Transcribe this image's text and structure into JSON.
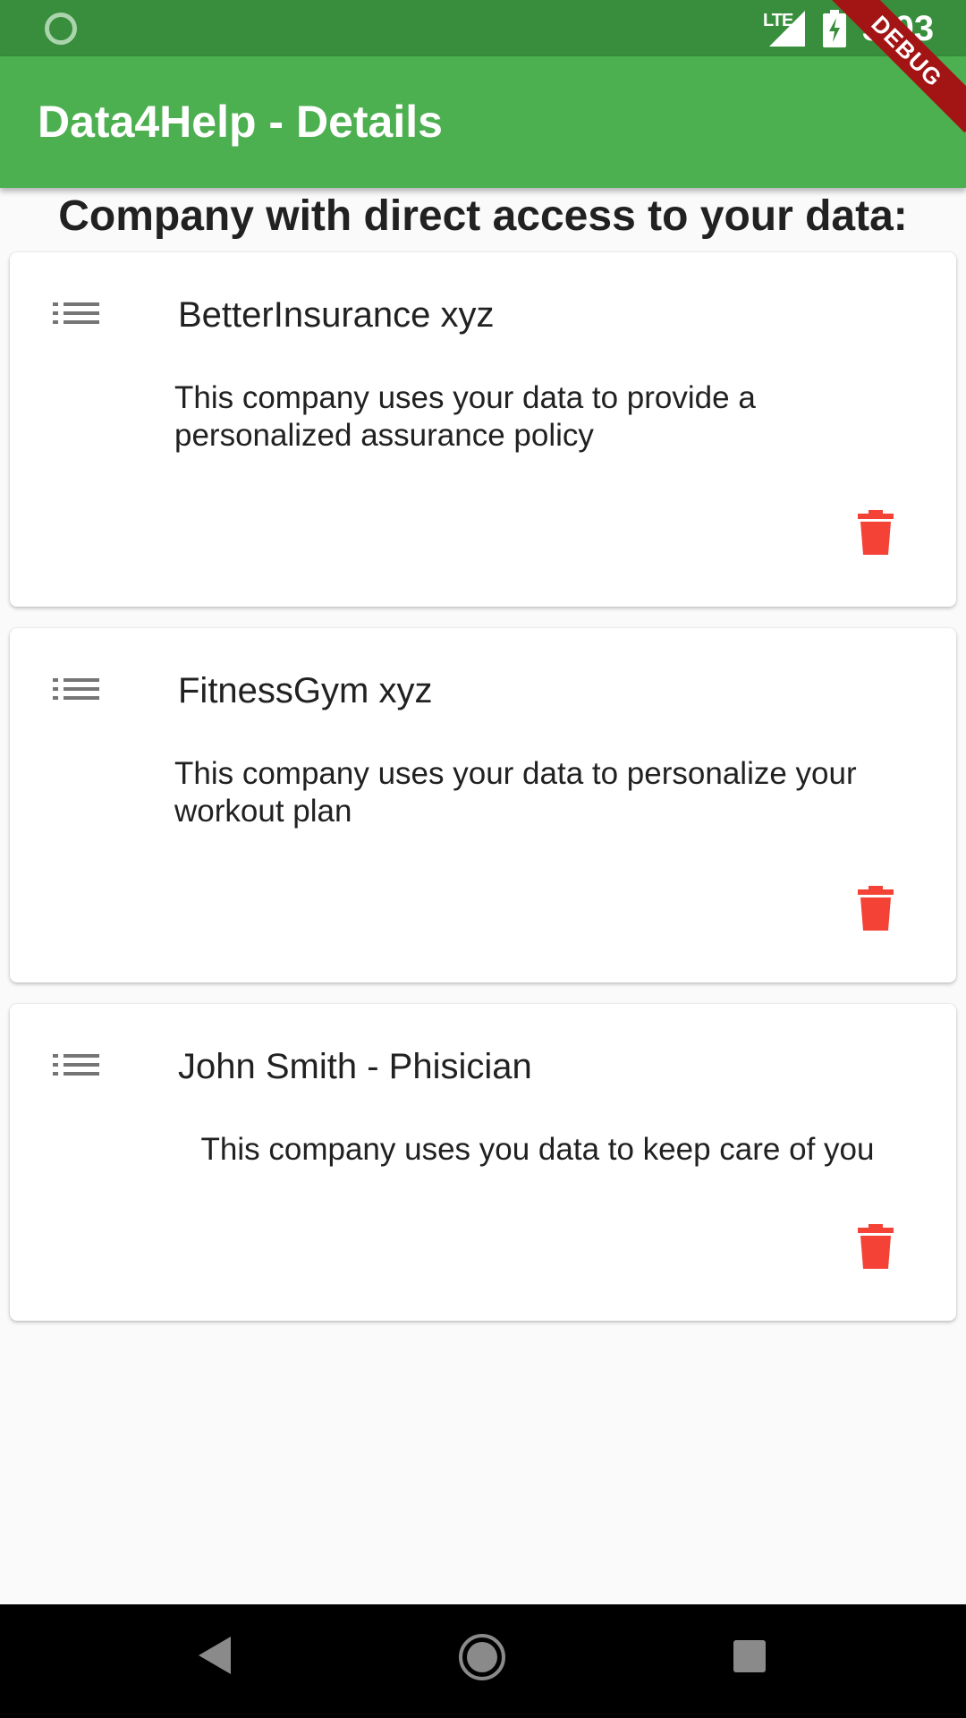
{
  "status_bar": {
    "network": "LTE",
    "time": "3:03"
  },
  "debug_banner": "DEBUG",
  "app_bar": {
    "title": "Data4Help - Details"
  },
  "section": {
    "heading": "Company with direct access to your data:"
  },
  "companies": [
    {
      "name": "BetterInsurance xyz",
      "description": "This company uses your data to provide a personalized assurance policy"
    },
    {
      "name": "FitnessGym xyz",
      "description": "This company uses your data to personalize your workout plan"
    },
    {
      "name": "John Smith - Phisician",
      "description": "This company uses you data to keep care of you"
    }
  ],
  "icons": {
    "list": "list-icon",
    "delete": "trash-icon"
  },
  "colors": {
    "status_bar": "#388e3c",
    "app_bar": "#4caf50",
    "delete": "#f44336",
    "list_icon": "#757575",
    "debug": "#a31515"
  }
}
